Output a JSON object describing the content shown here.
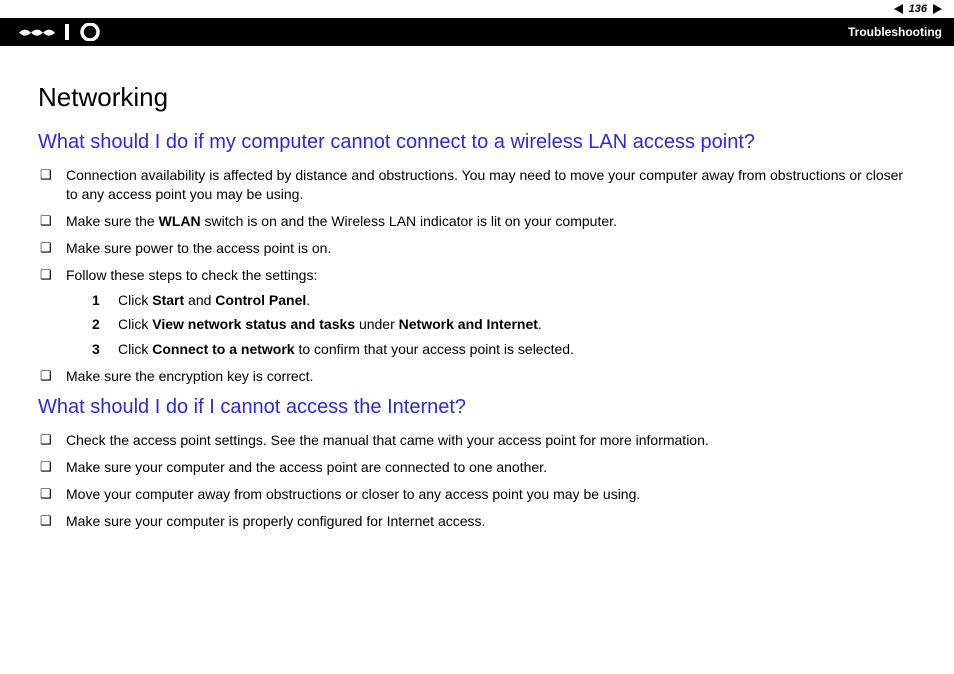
{
  "nav": {
    "page_number": "136"
  },
  "header": {
    "section": "Troubleshooting"
  },
  "page": {
    "title": "Networking"
  },
  "q1": {
    "heading": "What should I do if my computer cannot connect to a wireless LAN access point?",
    "b1": "Connection availability is affected by distance and obstructions. You may need to move your computer away from obstructions or closer to any access point you may be using.",
    "b2a": "Make sure the ",
    "b2b": "WLAN",
    "b2c": " switch is on and the Wireless LAN indicator is lit on your computer.",
    "b3": "Make sure power to the access point is on.",
    "b4": "Follow these steps to check the settings:",
    "s1a": "Click ",
    "s1b": "Start",
    "s1c": " and ",
    "s1d": "Control Panel",
    "s1e": ".",
    "s2a": "Click ",
    "s2b": "View network status and tasks",
    "s2c": " under ",
    "s2d": "Network and Internet",
    "s2e": ".",
    "s3a": "Click ",
    "s3b": "Connect to a network",
    "s3c": " to confirm that your access point is selected.",
    "b5": "Make sure the encryption key is correct."
  },
  "q2": {
    "heading": "What should I do if I cannot access the Internet?",
    "b1": "Check the access point settings. See the manual that came with your access point for more information.",
    "b2": "Make sure your computer and the access point are connected to one another.",
    "b3": "Move your computer away from obstructions or closer to any access point you may be using.",
    "b4": "Make sure your computer is properly configured for Internet access."
  },
  "steps": {
    "n1": "1",
    "n2": "2",
    "n3": "3"
  }
}
